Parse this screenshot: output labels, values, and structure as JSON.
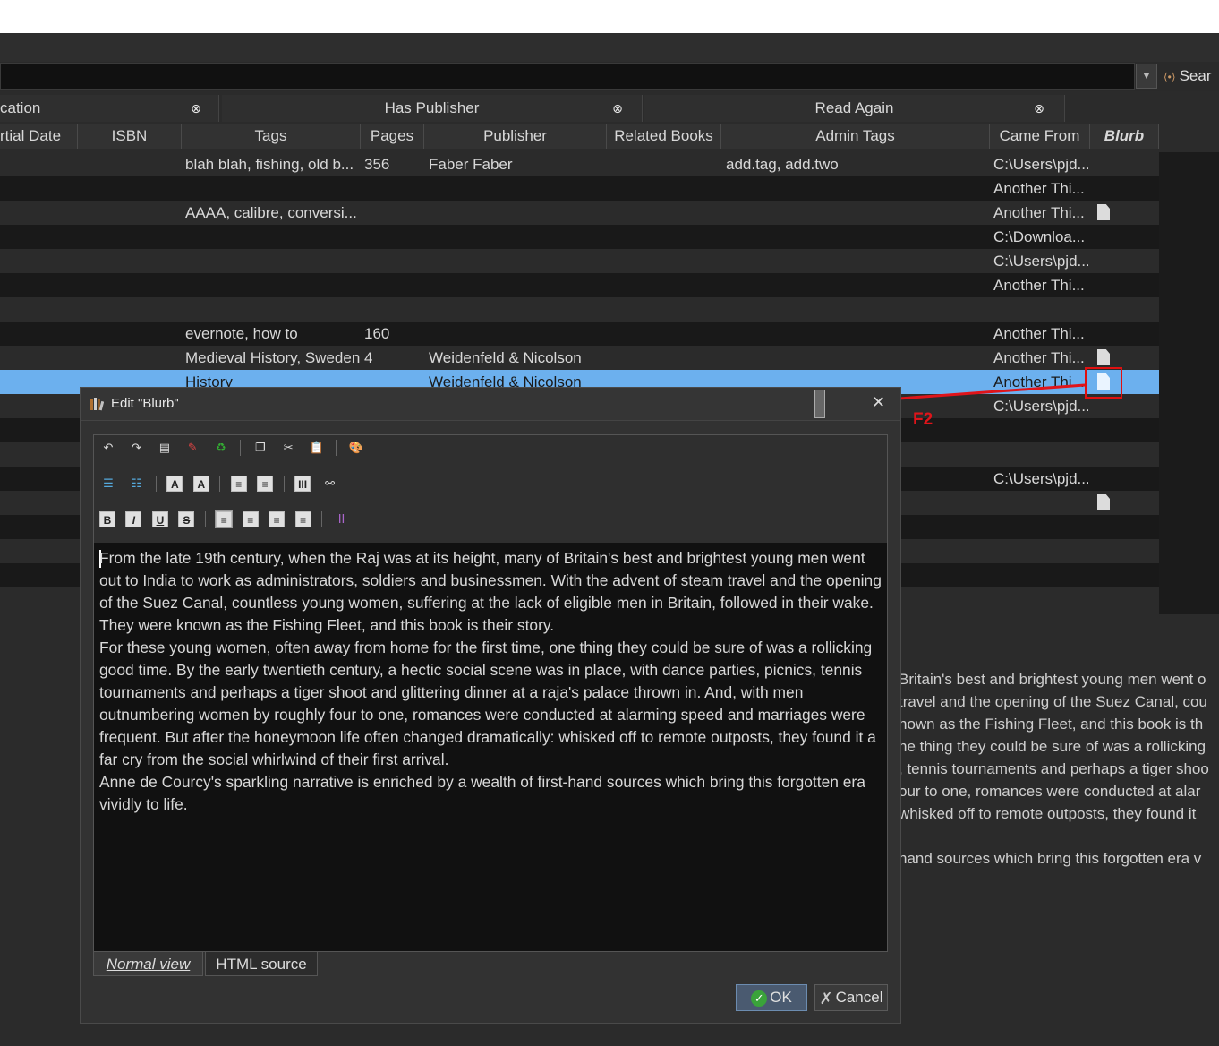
{
  "search": {
    "button_label": "Sear"
  },
  "virtual_libraries": [
    {
      "label": "cation"
    },
    {
      "label": "Has Publisher"
    },
    {
      "label": "Read Again"
    }
  ],
  "columns": [
    "rtial Date",
    "ISBN",
    "Tags",
    "Pages",
    "Publisher",
    "Related Books",
    "Admin Tags",
    "Came From",
    "Blurb"
  ],
  "rows": [
    {
      "tags": "blah blah, fishing, old b...",
      "pages": "356",
      "publisher": "Faber  Faber",
      "admin": "add.tag, add.two",
      "from": "C:\\Users\\pjd...",
      "doc": false
    },
    {
      "tags": "",
      "pages": "",
      "publisher": "",
      "admin": "",
      "from": "Another Thi...",
      "doc": false
    },
    {
      "tags": "AAAA, calibre, conversi...",
      "pages": "",
      "publisher": "",
      "admin": "",
      "from": "Another Thi...",
      "doc": true
    },
    {
      "tags": "",
      "pages": "",
      "publisher": "",
      "admin": "",
      "from": "C:\\Downloa...",
      "doc": false
    },
    {
      "tags": "",
      "pages": "",
      "publisher": "",
      "admin": "",
      "from": "C:\\Users\\pjd...",
      "doc": false
    },
    {
      "tags": "",
      "pages": "",
      "publisher": "",
      "admin": "",
      "from": "Another Thi...",
      "doc": false
    },
    {
      "tags": "",
      "pages": "",
      "publisher": "",
      "admin": "",
      "from": "",
      "doc": false
    },
    {
      "tags": "evernote, how to",
      "pages": "160",
      "publisher": "",
      "admin": "",
      "from": "Another Thi...",
      "doc": false
    },
    {
      "tags": "Medieval History, Sweden",
      "pages": "4",
      "publisher": "Weidenfeld & Nicolson",
      "admin": "",
      "from": "Another Thi...",
      "doc": true
    },
    {
      "tags": "History",
      "pages": "",
      "publisher": "Weidenfeld & Nicolson",
      "admin": "",
      "from": "Another Thi...",
      "doc": true,
      "selected": true
    },
    {
      "tags": "",
      "pages": "",
      "publisher": "",
      "admin": "",
      "from": "C:\\Users\\pjd...",
      "doc": false
    },
    {
      "tags": "",
      "pages": "",
      "publisher": "",
      "admin": "",
      "from": "",
      "doc": false
    },
    {
      "tags": "",
      "pages": "",
      "publisher": "",
      "admin": "",
      "from": "",
      "doc": false
    },
    {
      "tags": "",
      "pages": "",
      "publisher": "",
      "admin": "",
      "from": "C:\\Users\\pjd...",
      "doc": false
    },
    {
      "tags": "",
      "pages": "",
      "publisher": "",
      "admin": "",
      "from": "",
      "doc": true
    },
    {
      "tags": "",
      "pages": "",
      "publisher": "",
      "admin": "",
      "from": "",
      "doc": false
    },
    {
      "tags": "",
      "pages": "",
      "publisher": "",
      "admin": "",
      "from": "",
      "doc": false
    },
    {
      "tags": "",
      "pages": "",
      "publisher": "",
      "admin": "",
      "from": "",
      "doc": false
    },
    {
      "tags": "",
      "pages": "",
      "publisher": "",
      "admin": "",
      "from": "",
      "doc": false
    }
  ],
  "annotation": {
    "label": "F2"
  },
  "background_text": [
    "Britain's best and brightest young men went o",
    " travel and the opening of the Suez Canal, cou",
    "nown as the Fishing Fleet, and this book is th",
    "ne thing they could be sure of was a rollicking",
    ", tennis tournaments and perhaps a tiger shoo",
    "our to one, romances were conducted at alar",
    "whisked off to remote outposts, they found it",
    "",
    "hand sources which bring this forgotten era v"
  ],
  "dialog": {
    "title": "Edit \"Blurb\"",
    "paragraphs": [
      "From the late 19th century, when the Raj was at its height, many of Britain's best and brightest young men went out to India to work as administrators, soldiers and businessmen. With the advent of steam travel and the opening of the Suez Canal, countless young women, suffering at the lack of eligible men in Britain, followed in their wake. They were known as the Fishing Fleet, and this book is their story.",
      "For these young women, often away from home for the first time, one thing they could be sure of was a rollicking good time. By the early twentieth century, a hectic social scene was in place, with dance parties, picnics, tennis tournaments and perhaps a tiger shoot and glittering dinner at a raja's palace thrown in. And, with men outnumbering women by roughly four to one, romances were conducted at alarming speed and marriages were frequent. But after the honeymoon life often changed dramatically: whisked off to remote outposts, they found it a far cry from the social whirlwind of their first arrival.",
      "Anne de Courcy's sparkling narrative is enriched by a wealth of first-hand sources which bring this forgotten era vividly to life."
    ],
    "tab_normal": "Normal view",
    "tab_html": "HTML source",
    "ok_label": "OK",
    "cancel_label": "Cancel"
  },
  "colors": {
    "selection": "#6cb0ee",
    "annotation_red": "#e0141a",
    "ok_green": "#3aa33a"
  }
}
